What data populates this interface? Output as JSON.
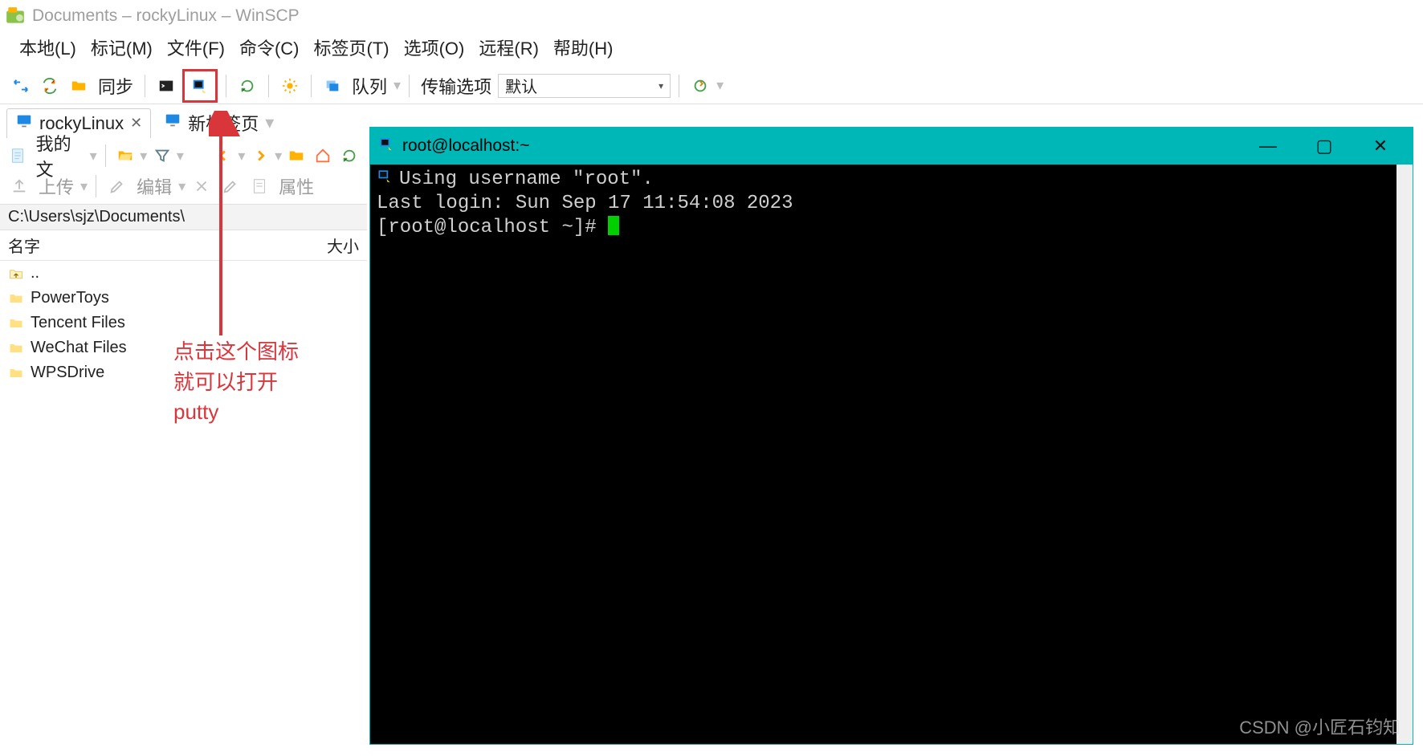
{
  "title": "Documents – rockyLinux – WinSCP",
  "menu": {
    "local": "本地(L)",
    "mark": "标记(M)",
    "file": "文件(F)",
    "command": "命令(C)",
    "tabs": "标签页(T)",
    "options": "选项(O)",
    "remote": "远程(R)",
    "help": "帮助(H)"
  },
  "toolbar": {
    "sync": "同步",
    "queue": "队列",
    "transfer_opts_label": "传输选项",
    "transfer_opts_value": "默认"
  },
  "tabs": {
    "session": "rockyLinux",
    "new_tab": "新标签页"
  },
  "nav": {
    "mydocs": "我的文"
  },
  "actions": {
    "upload": "上传",
    "edit": "编辑",
    "properties": "属性"
  },
  "path": "C:\\Users\\sjz\\Documents\\",
  "columns": {
    "name": "名字",
    "size": "大小"
  },
  "files": [
    {
      "name": "..",
      "up": true
    },
    {
      "name": "PowerToys"
    },
    {
      "name": "Tencent Files"
    },
    {
      "name": "WeChat Files"
    },
    {
      "name": "WPSDrive"
    }
  ],
  "annotation": {
    "line1": "点击这个图标",
    "line2": "就可以打开",
    "line3": "putty"
  },
  "putty": {
    "title": "root@localhost:~",
    "line_user": "Using username \"root\".",
    "line_last": "Last login: Sun Sep 17 11:54:08 2023",
    "prompt": "[root@localhost ~]# "
  },
  "watermark": "CSDN @小匠石钧知"
}
